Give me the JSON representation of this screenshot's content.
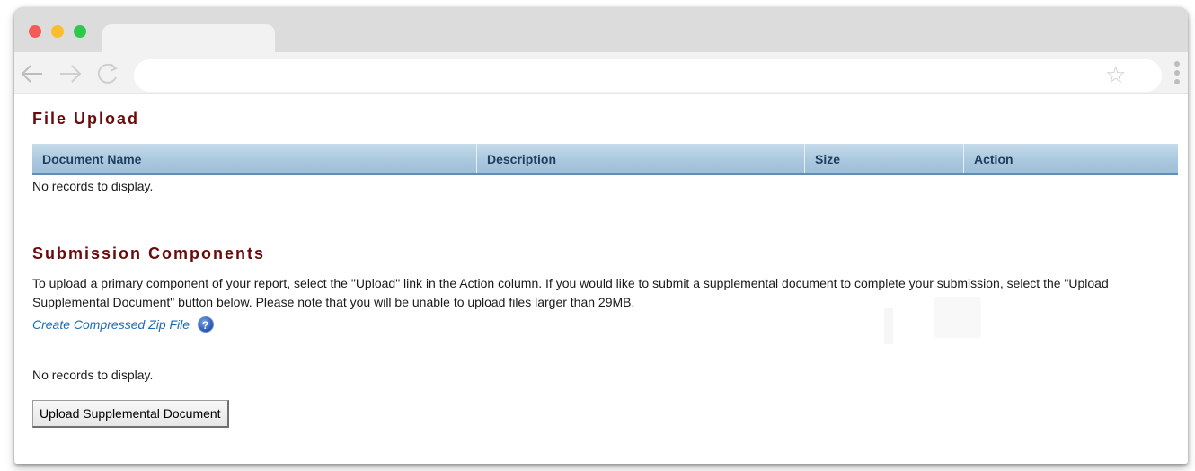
{
  "browser": {
    "tab_title": "",
    "address": ""
  },
  "file_upload": {
    "title": "File Upload",
    "columns": [
      "Document Name",
      "Description",
      "Size",
      "Action"
    ],
    "empty_text": "No records to display."
  },
  "submission": {
    "title": "Submission Components",
    "instructions": "To upload a primary component of your report, select the \"Upload\" link in the Action column. If you would like to submit a supplemental document to complete your submission, select the \"Upload Supplemental Document\" button below. Please note that you will be unable to upload files larger than 29MB.",
    "zip_link": "Create Compressed Zip File",
    "help_glyph": "?",
    "empty_text": "No records to display.",
    "upload_button": "Upload Supplemental Document"
  },
  "icons": {
    "back": "arrow-left-icon",
    "forward": "arrow-right-icon",
    "reload": "reload-icon",
    "bookmark": "star-icon",
    "menu": "kebab-menu-icon",
    "help": "help-icon"
  },
  "colors": {
    "section_title": "#6b0a0a",
    "grid_header": "#aac8de",
    "link": "#1b6bb5",
    "traffic_red": "#f45b56",
    "traffic_yellow": "#fbbd2d",
    "traffic_green": "#30c84a"
  }
}
